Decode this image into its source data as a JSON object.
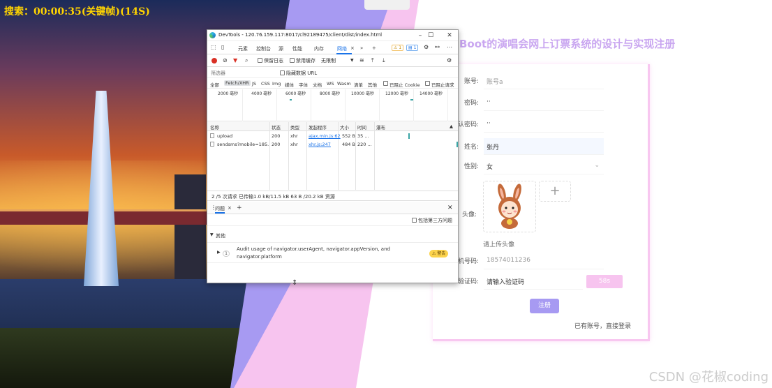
{
  "overlay": {
    "timer_text": "搜索：00:00:35(关键帧)(14S)"
  },
  "page": {
    "title": "Boot的演唱会网上订票系统的设计与实现注册"
  },
  "form": {
    "fields": [
      {
        "label": "账号:",
        "value": "账号a",
        "style": "placeholder"
      },
      {
        "label": "密码:",
        "value": "··",
        "style": "value"
      },
      {
        "label": "确认密码:",
        "value": "··",
        "style": "value"
      },
      {
        "label": "姓名:",
        "value": "张丹",
        "style": "value"
      },
      {
        "label": "性别:",
        "value": "女",
        "style": "value"
      }
    ],
    "avatar_label": "头像:",
    "upload_hint": "请上传头像",
    "phone_label": "手机号码:",
    "phone_value": "18574011236",
    "code_label": "验证码:",
    "code_placeholder": "请输入验证码",
    "code_button": "58s",
    "register_button": "注册",
    "login_link": "已有账号，直接登录"
  },
  "devtools": {
    "window_title": "DevTools - 120.76.159.117:8017/cl92189475/client/dist/index.html",
    "tabs": [
      "元素",
      "控制台",
      "源",
      "性能",
      "内存",
      "网络",
      "»",
      "+"
    ],
    "active_tab": "网络",
    "warn_count": "1",
    "info_count": "1",
    "toolbar": {
      "preserve_log": "保留日志",
      "disable_cache": "禁用缓存",
      "throttle": "无限制"
    },
    "filter_placeholder": "筛选器",
    "hide_data_urls": "隐藏数据 URL",
    "type_filters": [
      "全部",
      "Fetch/XHR",
      "JS",
      "CSS",
      "Img",
      "媒体",
      "字体",
      "文档",
      "WS",
      "Wasm",
      "清单",
      "其他"
    ],
    "blocked_cookies": "已阻止 Cookie",
    "blocked_requests": "已阻止请求",
    "timeline_ticks": [
      "2000 毫秒",
      "4000 毫秒",
      "6000 毫秒",
      "8000 毫秒",
      "10000 毫秒",
      "12000 毫秒",
      "14000 毫秒"
    ],
    "columns": [
      "名称",
      "状态",
      "类型",
      "发起程序",
      "大小",
      "时间",
      "瀑布"
    ],
    "rows": [
      {
        "name": "upload",
        "status": "200",
        "type": "xhr",
        "initiator": "ajax.min.js:62",
        "size": "552 B",
        "time": "35 ..."
      },
      {
        "name": "sendsms?mobile=185...",
        "status": "200",
        "type": "xhr",
        "initiator": "xhr.js:247",
        "size": "484 B",
        "time": "220 ..."
      }
    ],
    "status_bar": "2 /5 次请求  已传输1.0 kB/11.5 kB  63 B /20.2 kB 资源",
    "drawer_tab": "问题",
    "third_party": "包括第三方问题",
    "group": "其他",
    "issue_count": "1",
    "issue_text": "Audit usage of navigator.userAgent, navigator.appVersion, and navigator.platform",
    "issue_badge": "警告"
  },
  "watermark": "CSDN @花椒coding"
}
